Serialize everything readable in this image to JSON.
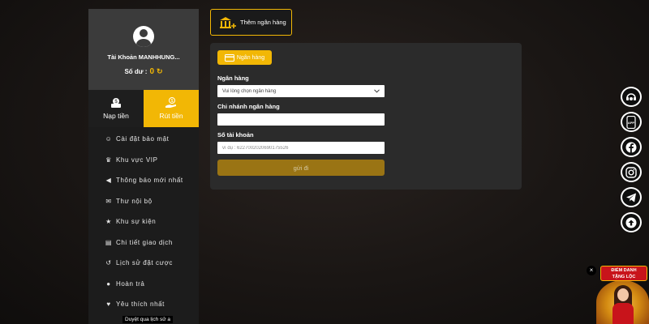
{
  "sidebar": {
    "account_name": "Tài Khoản MANHHUNG...",
    "balance_label": "Số dư :",
    "balance_value": "0",
    "deposit_label": "Nạp tiền",
    "withdraw_label": "Rút tiền",
    "menu": [
      {
        "label": "Cài đặt bảo mật",
        "icon": "user-lock-icon"
      },
      {
        "label": "Khu vực VIP",
        "icon": "crown-icon"
      },
      {
        "label": "Thông báo mới nhất",
        "icon": "megaphone-icon"
      },
      {
        "label": "Thư nội bộ",
        "icon": "envelope-icon"
      },
      {
        "label": "Khu sự kiện",
        "icon": "trophy-icon"
      },
      {
        "label": "Chi tiết giao dịch",
        "icon": "clipboard-icon"
      },
      {
        "label": "Lịch sử đặt cược",
        "icon": "history-icon"
      },
      {
        "label": "Hoàn trả",
        "icon": "dollar-icon"
      },
      {
        "label": "Yêu thích nhất",
        "icon": "heart-icon"
      }
    ],
    "tooltip": "Duyệt qua lịch sử a"
  },
  "top": {
    "add_bank_label": "Thêm ngân hàng"
  },
  "form": {
    "tab_label": "Ngân hàng",
    "bank_label": "Ngân hàng",
    "bank_select_value": "Vui lòng chọn ngân hàng",
    "branch_label": "Chi nhánh ngân hàng",
    "branch_value": "",
    "account_label": "Số tài khoản",
    "account_placeholder": "ví dụ : 6227002020690175526",
    "submit_label": "gửi đi"
  },
  "floating": {
    "items": [
      "support-icon",
      "app-download-icon",
      "facebook-icon",
      "instagram-icon",
      "telegram-icon",
      "scroll-top-icon"
    ],
    "app_text": "APP"
  },
  "promo": {
    "line1": "ĐIỂM DANH",
    "line2": "TẶNG LỘC",
    "close": "×"
  },
  "colors": {
    "accent": "#f2b705",
    "panel": "#2b2b2b",
    "sidebar": "#1c1c1c",
    "profile": "#3b3b3b",
    "submit": "#9a7414"
  }
}
